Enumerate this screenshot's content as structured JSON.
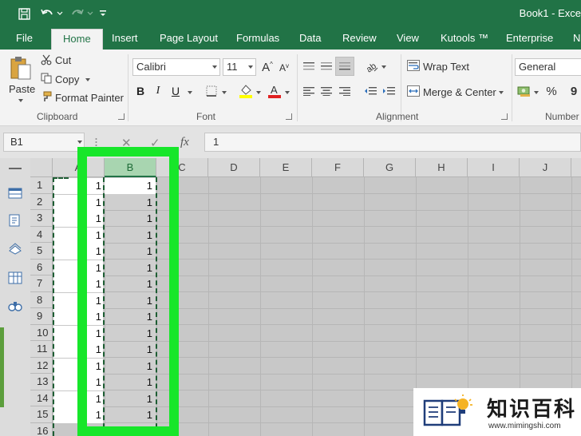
{
  "window": {
    "title": "Book1 - Exce"
  },
  "tabs": [
    "File",
    "Home",
    "Insert",
    "Page Layout",
    "Formulas",
    "Data",
    "Review",
    "View",
    "Kutools ™",
    "Enterprise",
    "N"
  ],
  "clipboard": {
    "paste": "Paste",
    "cut": "Cut",
    "copy": "Copy",
    "format_painter": "Format Painter",
    "label": "Clipboard"
  },
  "font": {
    "name": "Calibri",
    "size": "11",
    "bold": "B",
    "italic": "I",
    "underline": "U",
    "label": "Font"
  },
  "alignment": {
    "wrap_text": "Wrap Text",
    "merge_center": "Merge & Center",
    "label": "Alignment"
  },
  "number": {
    "format": "General",
    "percent": "%",
    "label": "Number"
  },
  "formula_bar": {
    "name_box": "B1",
    "fx": "fx",
    "value": "1"
  },
  "sheet": {
    "columns": [
      "A",
      "B",
      "C",
      "D",
      "E",
      "F",
      "G",
      "H",
      "I",
      "J"
    ],
    "rows": [
      "1",
      "2",
      "3",
      "4",
      "5",
      "6",
      "7",
      "8",
      "9",
      "10",
      "11",
      "12",
      "13",
      "14",
      "15",
      "16"
    ],
    "col_a_values": [
      "1",
      "1",
      "1",
      "1",
      "1",
      "1",
      "1",
      "1",
      "1",
      "1",
      "1",
      "1",
      "1",
      "1",
      "1"
    ],
    "col_b_values": [
      "1",
      "1",
      "1",
      "1",
      "1",
      "1",
      "1",
      "1",
      "1",
      "1",
      "1",
      "1",
      "1",
      "1",
      "1"
    ],
    "selected_column": "B",
    "active_cell": "B1"
  },
  "watermark": {
    "title": "知识百科",
    "url": "www.mimingshi.com"
  },
  "colors": {
    "excel_green": "#217346",
    "highlight_green": "#17e62a"
  }
}
